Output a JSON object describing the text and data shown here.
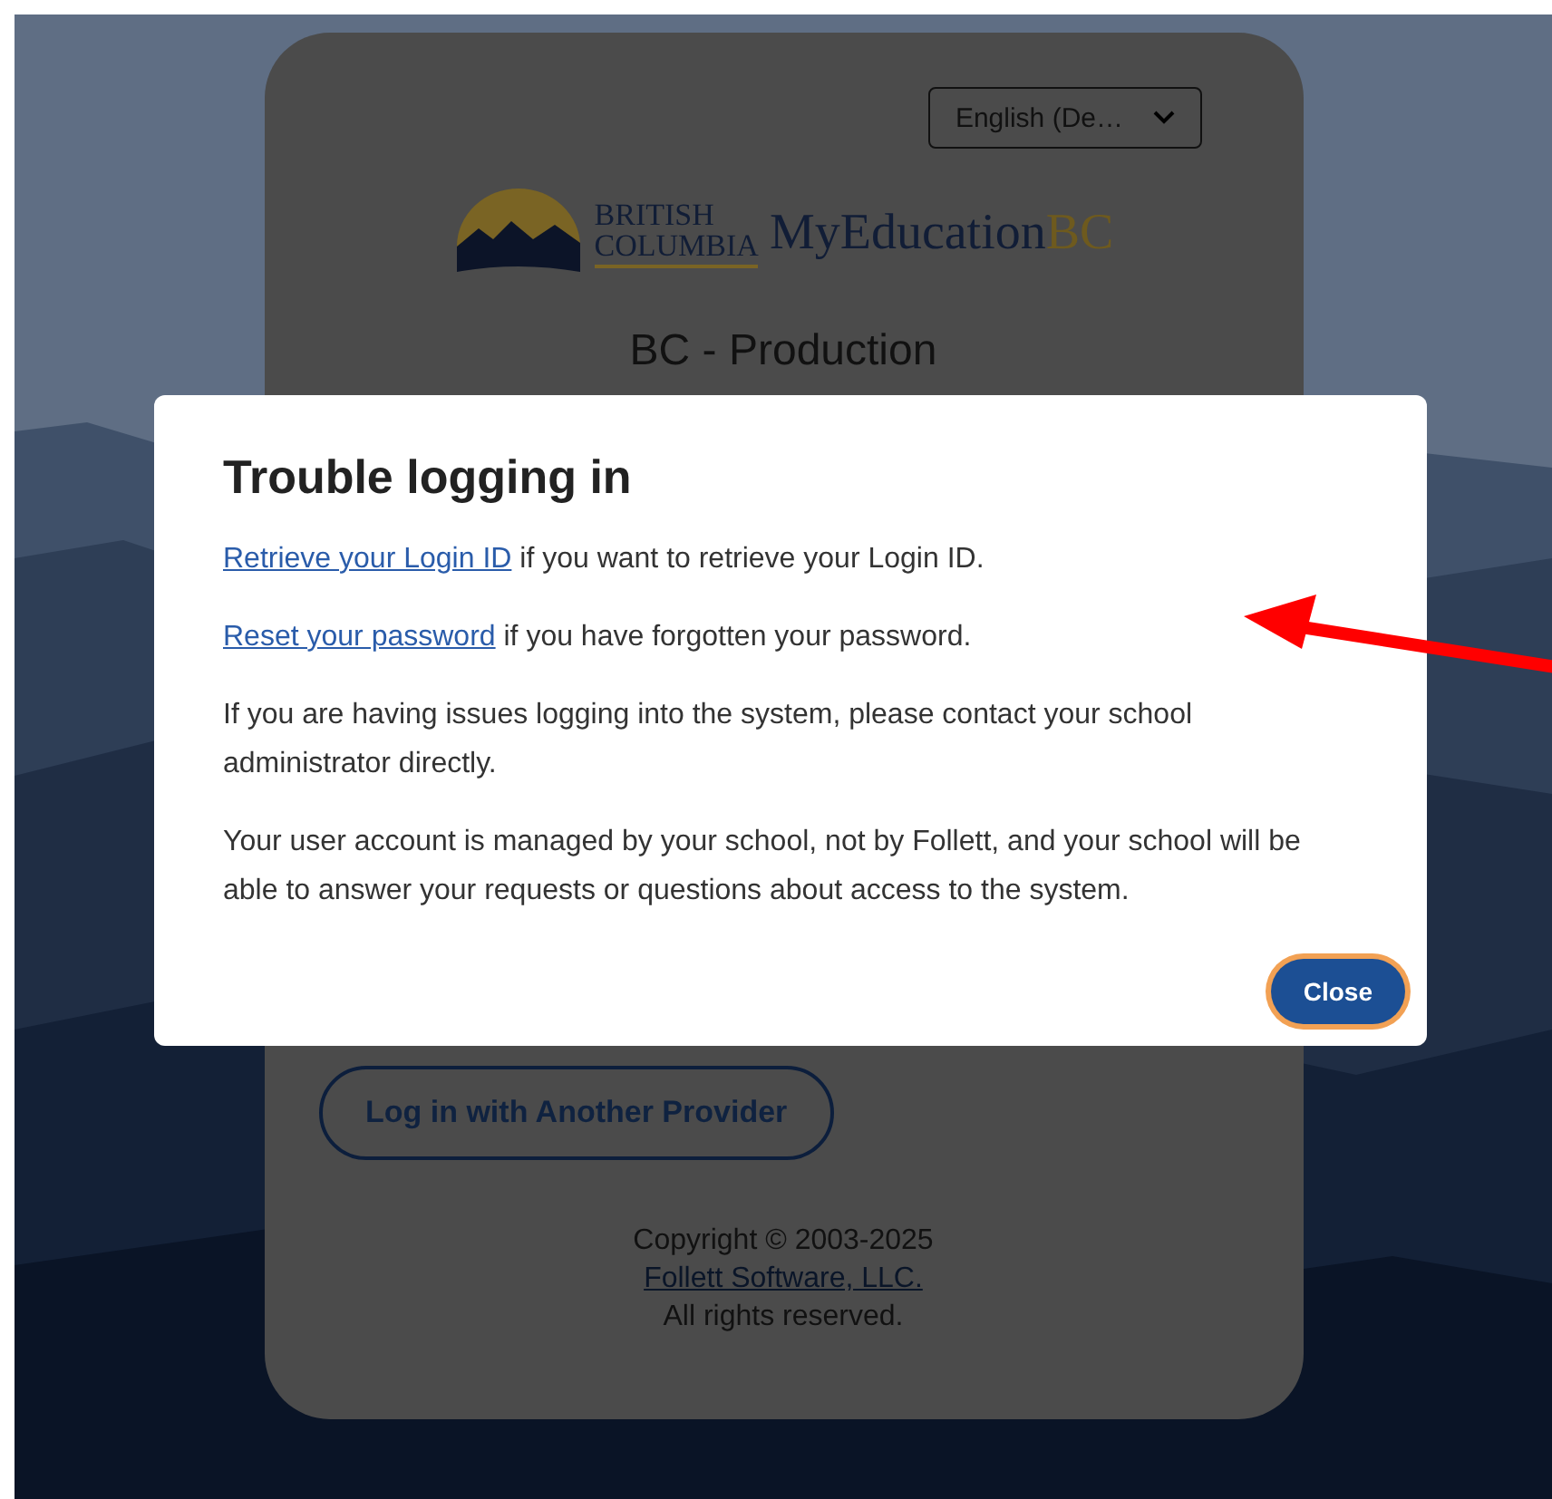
{
  "language_select": {
    "value": "English (De…"
  },
  "logo": {
    "province_line1": "BRITISH",
    "province_line2": "COLUMBIA",
    "product": "MyEducation",
    "product_suffix": "BC"
  },
  "environment": "BC - Production",
  "provider_button": "Log in with Another Provider",
  "footer": {
    "copyright": "Copyright © 2003-2025",
    "company_link": "Follett Software, LLC.",
    "rights": "All rights reserved."
  },
  "dialog": {
    "title": "Trouble logging in",
    "paragraphs": [
      {
        "link": "Retrieve your Login ID",
        "text": " if you want to retrieve your Login ID."
      },
      {
        "link": "Reset your password",
        "text": " if you have forgotten your password."
      },
      {
        "text": "If you are having issues logging into the system, please contact your school administrator directly."
      },
      {
        "text": "Your user account is managed by your school, not by Follett, and your school will be able to answer your requests or questions about access to the system."
      }
    ],
    "close_button": "Close"
  }
}
